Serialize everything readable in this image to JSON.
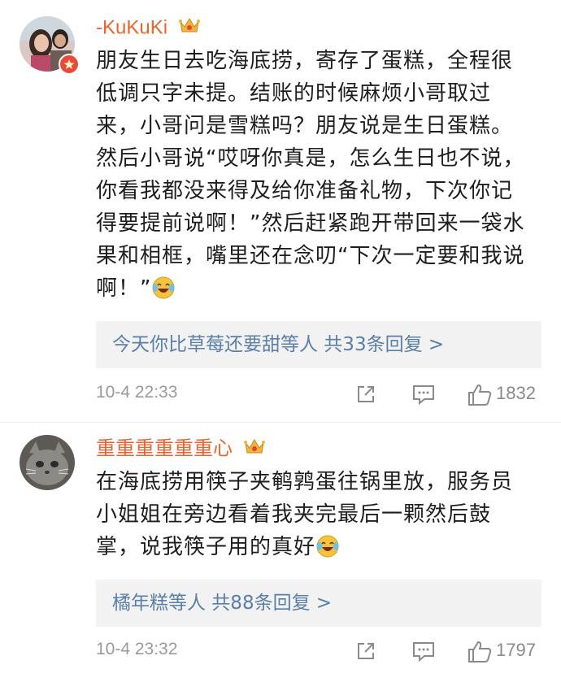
{
  "comments": [
    {
      "username": "-KuKuKi",
      "text_lines": [
        "朋友生日去吃海底捞，寄存了蛋糕，全程很",
        "低调只字未提。结账的时候麻烦小哥取过",
        "来，小哥问是雪糕吗？朋友说是生日蛋糕。",
        "然后小哥说“哎呀你真是，怎么生日也不说，",
        "你看我都没来得及给你准备礼物，下次你记",
        "得要提前说啊！”然后赶紧跑开带回来一袋水",
        "果和相框，嘴里还在念叨“下次一定要和我说",
        "啊！”"
      ],
      "emoji": "laugh-cry-emoji",
      "reply_summary": "今天你比草莓还要甜等人  共33条回复 >",
      "time": "10-4 22:33",
      "likes": "1832"
    },
    {
      "username": "重重重重重重心",
      "text_lines": [
        "在海底捞用筷子夹鹌鹑蛋往锅里放，服务员",
        "小姐姐在旁边看着我夹完最后一颗然后鼓",
        "掌，说我筷子用的真好"
      ],
      "emoji": "laugh-cry-emoji",
      "reply_summary": "橘年糕等人  共88条回复 >",
      "time": "10-4 23:32",
      "likes": "1797"
    }
  ],
  "colors": {
    "username": "#e8662c",
    "reply_link": "#5a7fa8",
    "meta_gray": "#9a9a9a",
    "reply_bg": "#f2f2f2"
  }
}
